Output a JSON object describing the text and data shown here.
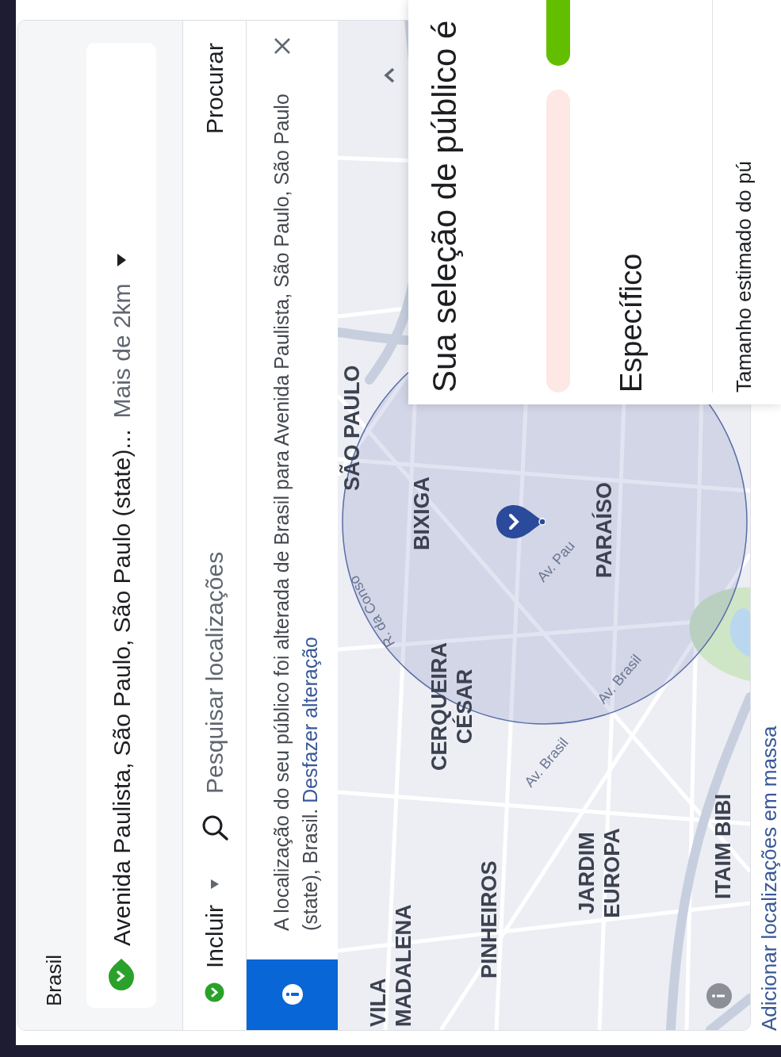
{
  "panel": {
    "label": "Brasil",
    "location": {
      "text": "Avenida Paulista, São Paulo, São Paulo (state)...",
      "radius": "Mais de 2km"
    },
    "search": {
      "mode": "Incluir",
      "placeholder": "Pesquisar localizações",
      "button": "Procurar"
    },
    "notice": {
      "text": "A localização do seu público foi alterada de Brasil para Avenida Paulista, São Paulo, São Paulo (state), Brasil.",
      "link": "Desfazer alteração"
    },
    "map": {
      "labels": [
        {
          "text": "SÃO PAULO",
          "kind": "area"
        },
        {
          "text": "BIXIGA",
          "kind": "area"
        },
        {
          "text": "CERQUEIRA CÉSAR",
          "kind": "area"
        },
        {
          "text": "PARAÍSO",
          "kind": "area"
        },
        {
          "text": "VILA MADALENA",
          "kind": "area"
        },
        {
          "text": "PINHEIROS",
          "kind": "area"
        },
        {
          "text": "JARDIM EUROPA",
          "kind": "area"
        },
        {
          "text": "ITAIM BIBI",
          "kind": "area"
        },
        {
          "text": "Av. Brasil",
          "kind": "street"
        },
        {
          "text": "Av. Brasil",
          "kind": "street"
        },
        {
          "text": "R. da Conso",
          "kind": "street"
        },
        {
          "text": "Av. Pau",
          "kind": "street"
        }
      ]
    },
    "bulk_link": "Adicionar localizações em massa"
  },
  "audience": {
    "title": "Sua seleção de público é",
    "gauge": [
      {
        "color": "#fde8e6"
      },
      {
        "color": "#63be00"
      }
    ],
    "verdict": "Específico",
    "size_label": "Tamanho estimado do pú"
  }
}
